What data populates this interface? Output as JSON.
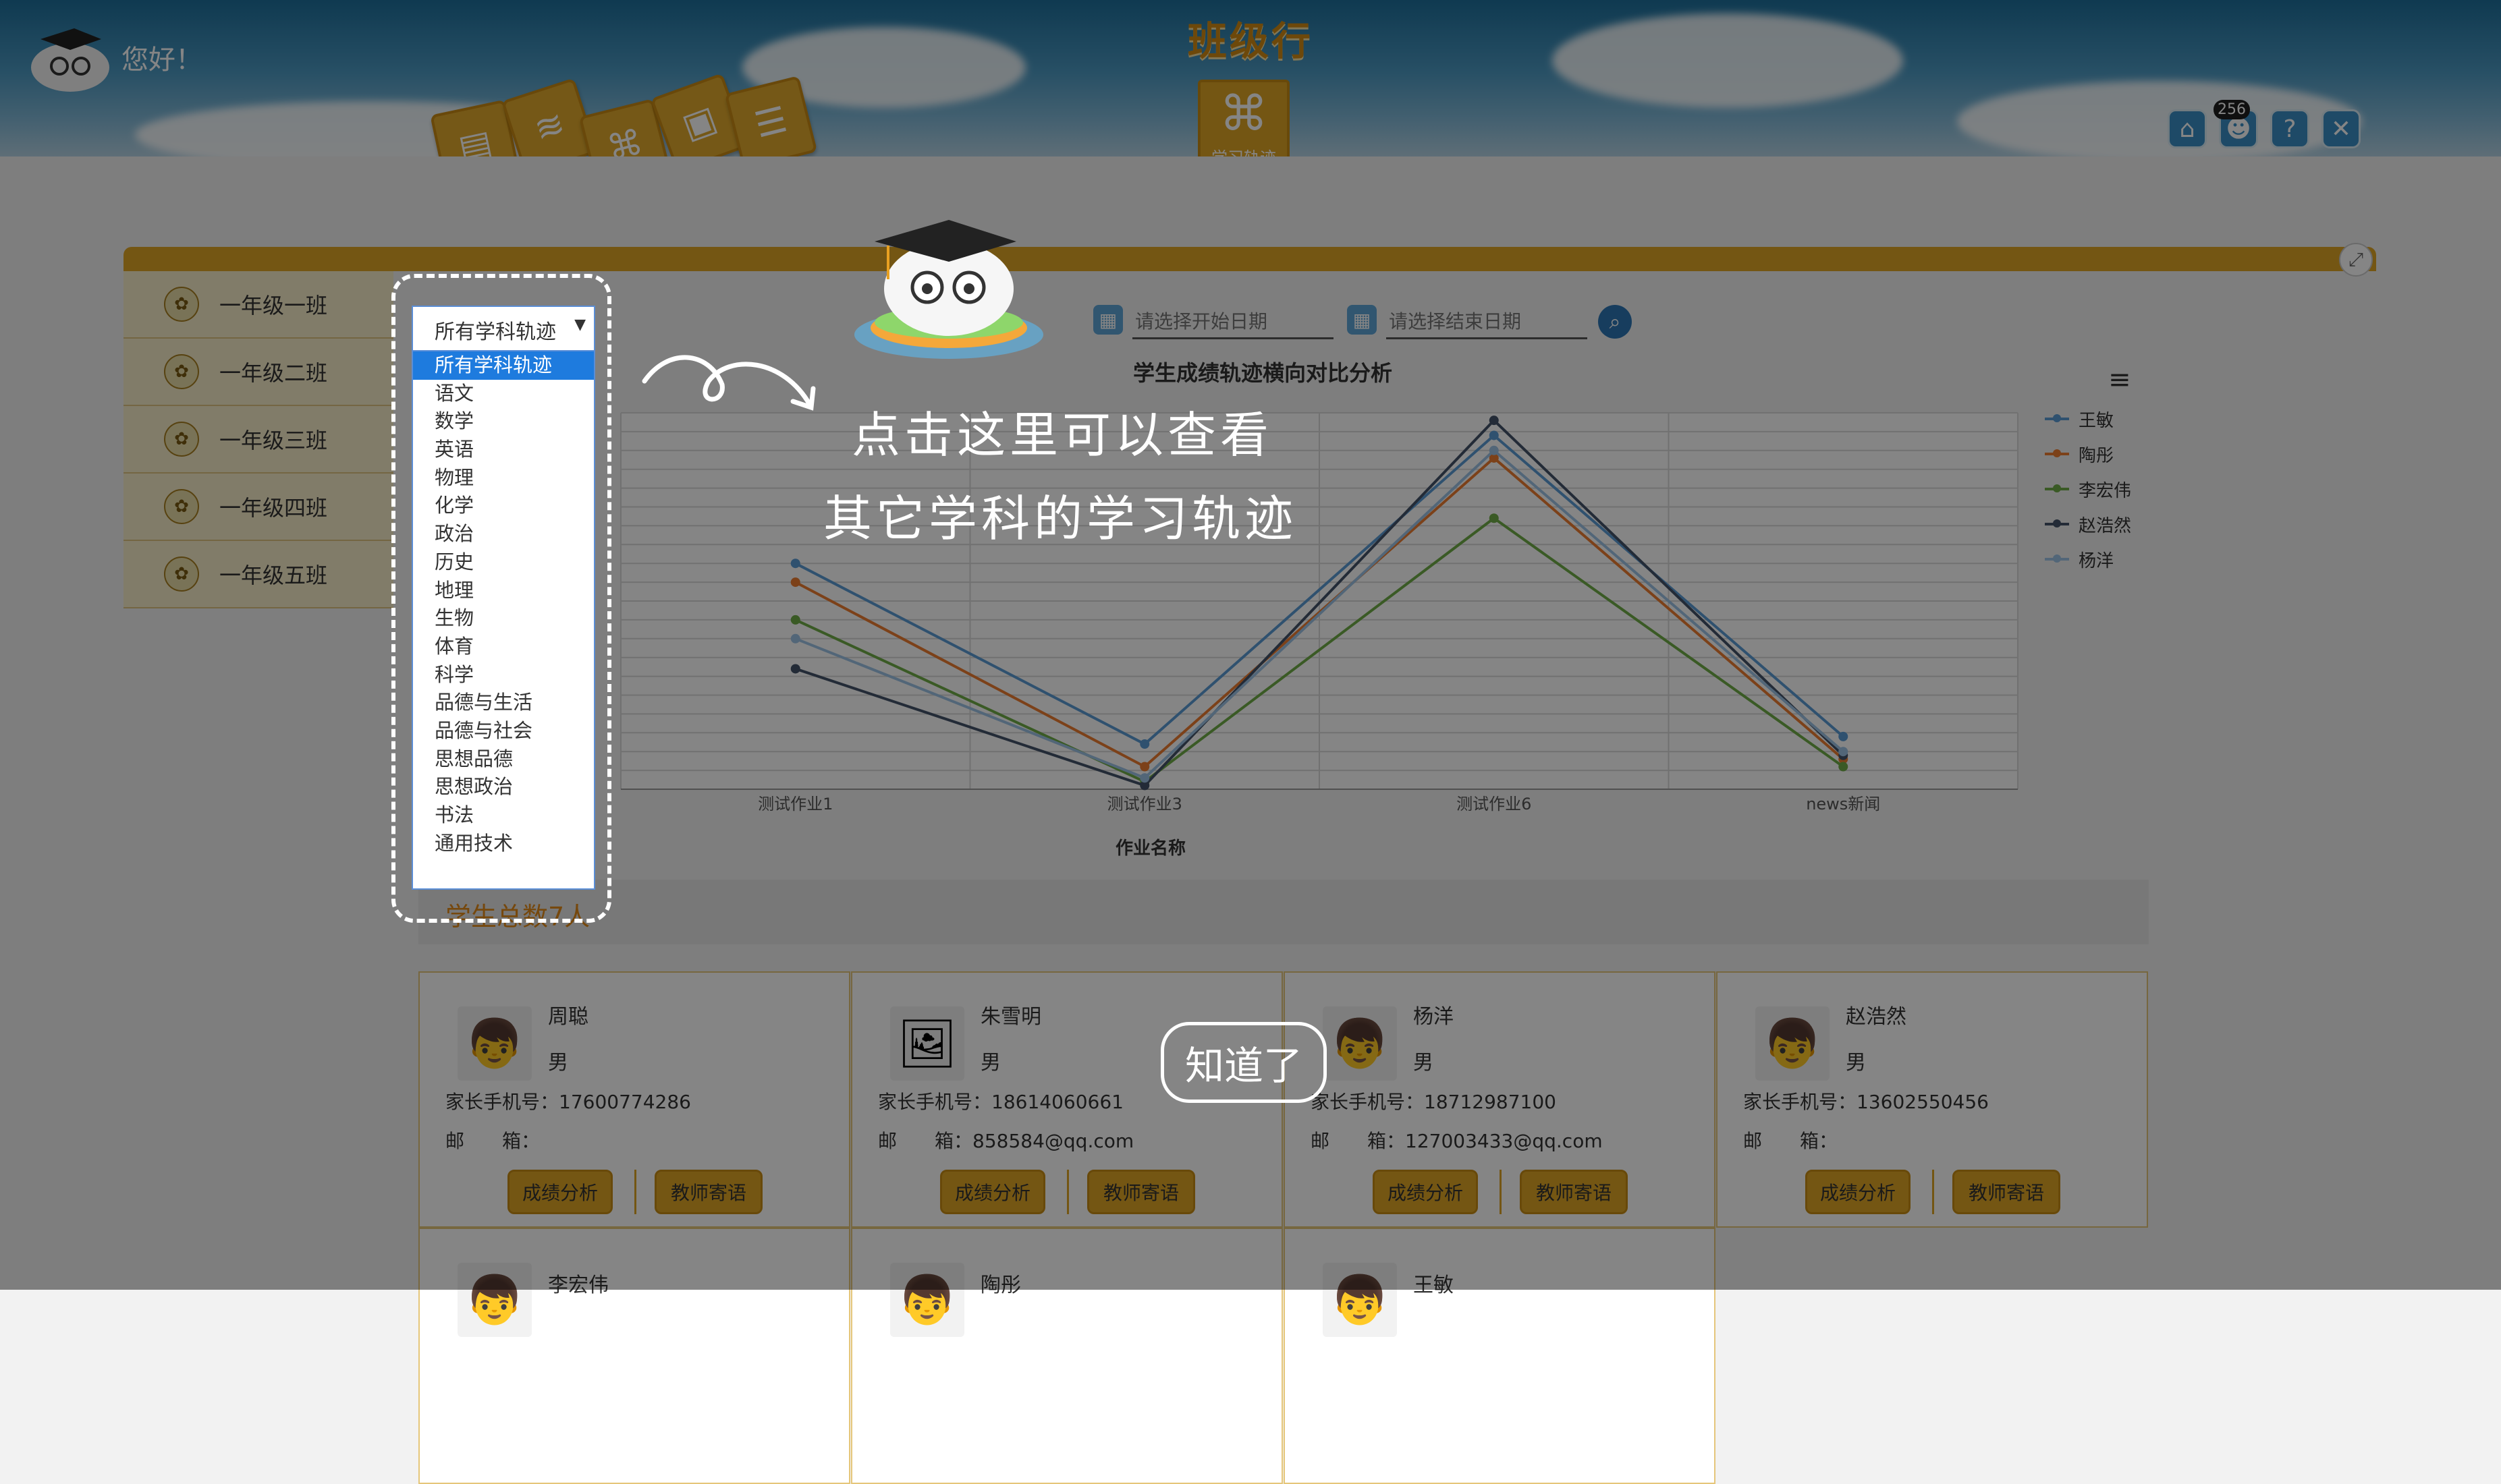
{
  "header": {
    "app_title": "班级行",
    "greeting": "您好！",
    "active_app_label": "学习轨迹",
    "notification_count": "256"
  },
  "sidebar": {
    "items": [
      {
        "label": "一年级一班"
      },
      {
        "label": "一年级二班"
      },
      {
        "label": "一年级三班"
      },
      {
        "label": "一年级四班"
      },
      {
        "label": "一年级五班"
      }
    ]
  },
  "filters": {
    "subject_selected": "所有学科轨迹",
    "start_date_placeholder": "请选择开始日期",
    "end_date_placeholder": "请选择结束日期"
  },
  "subject_options": [
    "所有学科轨迹",
    "语文",
    "数学",
    "英语",
    "物理",
    "化学",
    "政治",
    "历史",
    "地理",
    "生物",
    "体育",
    "科学",
    "品德与生活",
    "品德与社会",
    "思想品德",
    "思想政治",
    "书法",
    "通用技术"
  ],
  "chart_data": {
    "type": "line",
    "title": "学生成绩轨迹横向对比分析",
    "xlabel": "作业名称",
    "ylabel": "",
    "categories": [
      "测试作业1",
      "测试作业3",
      "测试作业6",
      "news新闻"
    ],
    "ylim": [
      0,
      100
    ],
    "grid": true,
    "legend_position": "right",
    "series": [
      {
        "name": "王敏",
        "color": "#5b9bd5",
        "values": [
          60,
          12,
          94,
          14
        ]
      },
      {
        "name": "陶彤",
        "color": "#ed7d31",
        "values": [
          55,
          6,
          88,
          8
        ]
      },
      {
        "name": "李宏伟",
        "color": "#70ad47",
        "values": [
          45,
          2,
          72,
          6
        ]
      },
      {
        "name": "赵浩然",
        "color": "#44546a",
        "values": [
          32,
          1,
          98,
          9
        ]
      },
      {
        "name": "杨洋",
        "color": "#9dc3e6",
        "values": [
          40,
          3,
          90,
          10
        ]
      }
    ]
  },
  "students": {
    "count_label": "学生总数7人",
    "phone_prefix": "家长手机号：",
    "email_prefix": "邮　　箱：",
    "btn_analysis": "成绩分析",
    "btn_message": "教师寄语",
    "items": [
      {
        "name": "周聪",
        "gender": "男",
        "phone": "17600774286",
        "email": ""
      },
      {
        "name": "朱雪明",
        "gender": "男",
        "phone": "18614060661",
        "email": "858584@qq.com"
      },
      {
        "name": "杨洋",
        "gender": "男",
        "phone": "18712987100",
        "email": "127003433@qq.com"
      },
      {
        "name": "赵浩然",
        "gender": "男",
        "phone": "13602550456",
        "email": ""
      },
      {
        "name": "李宏伟"
      },
      {
        "name": "陶彤"
      },
      {
        "name": "王敏"
      }
    ]
  },
  "tutorial": {
    "line1": "点击这里可以查看",
    "line2": "其它学科的学习轨迹",
    "got_it": "知道了"
  }
}
